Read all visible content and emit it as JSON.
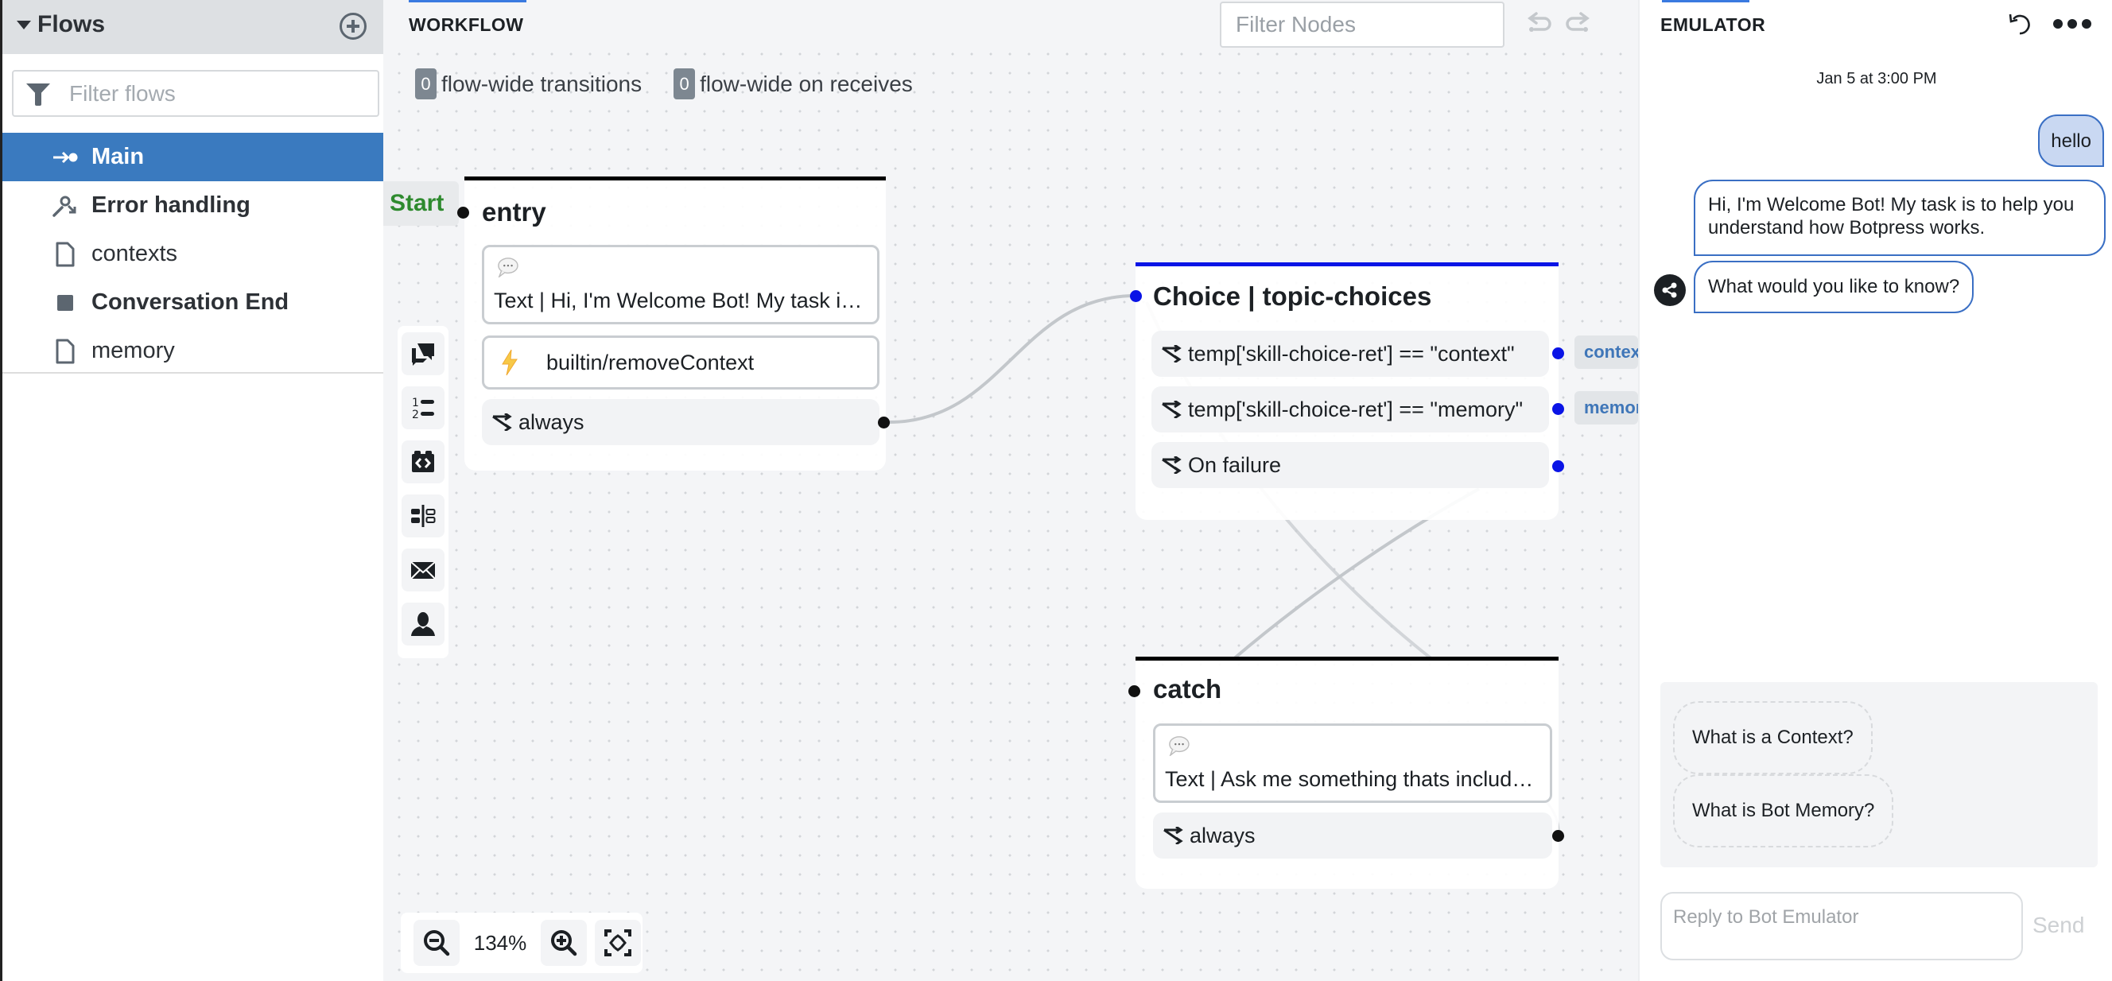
{
  "sidebar": {
    "title": "Flows",
    "filter_placeholder": "Filter flows",
    "flows": [
      {
        "label": "Main",
        "icon": "main-flow-icon",
        "active": true,
        "bold": true
      },
      {
        "label": "Error handling",
        "icon": "error-flow-icon",
        "active": false,
        "bold": true
      },
      {
        "label": "contexts",
        "icon": "file-icon",
        "active": false,
        "bold": false
      },
      {
        "label": "Conversation End",
        "icon": "square-icon",
        "active": false,
        "bold": true
      },
      {
        "label": "memory",
        "icon": "file-icon",
        "active": false,
        "bold": false
      }
    ]
  },
  "workflow": {
    "title": "WORKFLOW",
    "filter_placeholder": "Filter Nodes",
    "flow_wide_transitions": {
      "count": "0",
      "label": "flow-wide transitions"
    },
    "flow_wide_receives": {
      "count": "0",
      "label": "flow-wide on receives"
    },
    "start_label": "Start",
    "zoom_level": "134%",
    "nodes": {
      "entry": {
        "title": "entry",
        "say_text": "Text | Hi, I'm Welcome Bot! My task is ...",
        "action": "builtin/removeContext",
        "transitions": [
          "always"
        ]
      },
      "choice": {
        "title": "Choice | topic-choices",
        "transitions": [
          "temp['skill-choice-ret'] == \"context\"",
          "temp['skill-choice-ret'] == \"memory\"",
          "On failure"
        ],
        "targets": [
          "contexts",
          "memory"
        ]
      },
      "catch": {
        "title": "catch",
        "say_text": "Text | Ask me something thats include...",
        "transitions": [
          "always"
        ]
      }
    },
    "toolbox": [
      "say-something",
      "options-list",
      "execute-code",
      "router",
      "send-message",
      "user-input"
    ],
    "colors": {
      "choice_accent": "#0a14e6",
      "start_green": "#2e8a2e",
      "selection_blue": "#3a7abf"
    }
  },
  "emulator": {
    "title": "EMULATOR",
    "date": "Jan 5 at 3:00 PM",
    "messages": [
      {
        "from": "user",
        "text": "hello"
      },
      {
        "from": "bot",
        "text": "Hi, I'm Welcome Bot! My task is to help you understand how Botpress works."
      },
      {
        "from": "bot",
        "text": "What would you like to know?"
      }
    ],
    "quick_replies": [
      "What is a Context?",
      "What is Bot Memory?"
    ],
    "reply_placeholder": "Reply to Bot Emulator",
    "send_label": "Send"
  }
}
